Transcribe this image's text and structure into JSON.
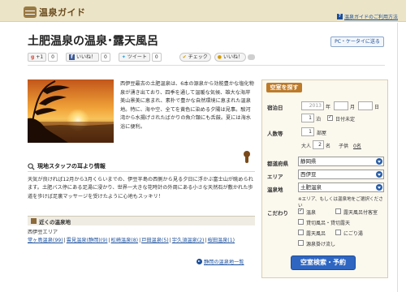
{
  "header": {
    "logo_text": "温泉ガイド",
    "help_link": "温泉ガイドのご利用方法"
  },
  "page": {
    "title": "土肥温泉の温泉･露天風呂",
    "pc_button": "PC・ケータイに送る"
  },
  "social": {
    "gplus_label": "+1",
    "gplus_count": "0",
    "fb_label": "いいね！",
    "fb_count": "0",
    "tweet_label": "ツイート",
    "tweet_count": "0",
    "check_label": "チェック",
    "mixi_label": "いいね！"
  },
  "intro": {
    "text": "西伊豆最古の土肥温泉は、6本の源泉から効能豊かな塩化物泉が湧き出ており、四季を通して温暖な気候、雄大な海岸美山景美に恵まれ、素朴で豊かな自然環境に恵まれた温泉地。特に、海や空、全てを黄色に染める夕陽は見事。駿河湾から水揚げされたばかりの魚介類にも舌鼓。夏には海水浴に便利。"
  },
  "staff": {
    "heading": "現地スタッフの耳より情報",
    "text": "天気が良ければ12月から3月くらいまでの、伊豆半島の西側から見る夕日に浮かぶ富士山が眺められます。土肥バス停にある足湯に浸かり、世界一大きな花時計の外周にある小さな天然石が敷かれた歩道を歩けば足裏マッサージを受けたように心地もスッキリ！"
  },
  "nearby": {
    "heading": "近くの温泉地",
    "area": "西伊豆エリア",
    "links": [
      "堂ヶ島温泉(99)",
      "雲見温泉(静岡)(9)",
      "松崎温泉(8)",
      "戸田温泉(5)",
      "宇久須温泉(2)",
      "桜田温泉(1)"
    ],
    "more_link": "静岡の温泉地一覧"
  },
  "search": {
    "title": "空室を探す",
    "checkin_label": "宿泊日",
    "year_value": "2013",
    "year_unit": "年",
    "month_unit": "月",
    "day_unit": "日",
    "nights_value": "1",
    "nights_unit": "泊",
    "undecided_label": "日付未定",
    "rooms_label": "人数等",
    "rooms_value": "1",
    "rooms_unit": "部屋",
    "adult_label": "大人",
    "adult_value": "2",
    "adult_unit": "名",
    "child_label": "子供",
    "child_value": "0名",
    "pref_label": "都道府県",
    "pref_value": "静岡県",
    "area_label": "エリア",
    "area_value": "西伊豆",
    "onsen_label": "温泉地",
    "onsen_value": "土肥温泉",
    "note": "※エリア、もしくは温泉地をご選択ください",
    "kodawari_label": "こだわり",
    "options": [
      {
        "label": "温泉",
        "checked": true
      },
      {
        "label": "露天風呂付客室",
        "checked": false
      },
      {
        "label": "貸切風呂・貸切露天",
        "checked": false
      },
      {
        "label": "露天風呂",
        "checked": false
      },
      {
        "label": "にごり湯",
        "checked": false
      },
      {
        "label": "源泉掛け流し",
        "checked": false
      }
    ],
    "button": "空室検索・予約"
  }
}
